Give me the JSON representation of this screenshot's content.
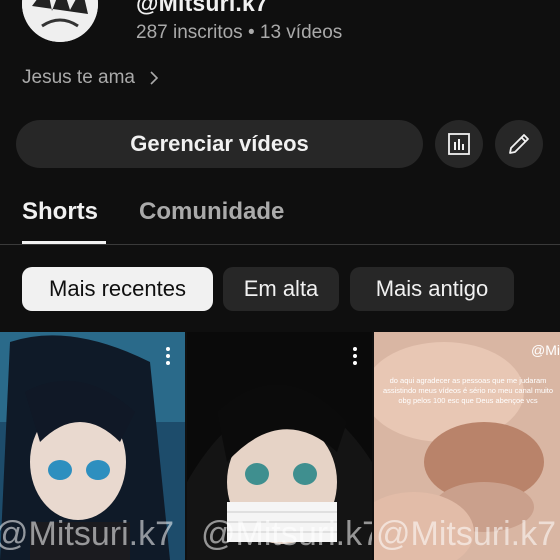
{
  "channel": {
    "handle": "@Mitsuri.k7",
    "stats": "287 inscritos • 13 vídeos",
    "description": "Jesus te ama"
  },
  "actions": {
    "manage_label": "Gerenciar vídeos",
    "analytics_icon": "analytics-icon",
    "edit_icon": "pencil-icon"
  },
  "tabs": [
    {
      "label": "Shorts",
      "active": true
    },
    {
      "label": "Comunidade",
      "active": false
    }
  ],
  "filters": [
    {
      "label": "Mais recentes",
      "active": true
    },
    {
      "label": "Em alta",
      "active": false
    },
    {
      "label": "Mais antigo",
      "active": false
    }
  ],
  "shorts": [
    {
      "watermark": "@Mitsuri.k7"
    },
    {
      "watermark": "@Mitsuri.k7"
    },
    {
      "watermark": "@Mitsuri.k7",
      "top_watermark": "@Mi",
      "caption": "do aqui agradecer as pessoas que me judaram assistindo meus vídeos é sério no meu canal muito obg pelos 100 esc que Deus abençoe vcs"
    }
  ],
  "colors": {
    "background": "#0f0f0f",
    "surface": "#272727",
    "text_primary": "#f1f1f1",
    "text_secondary": "#aaaaaa"
  }
}
